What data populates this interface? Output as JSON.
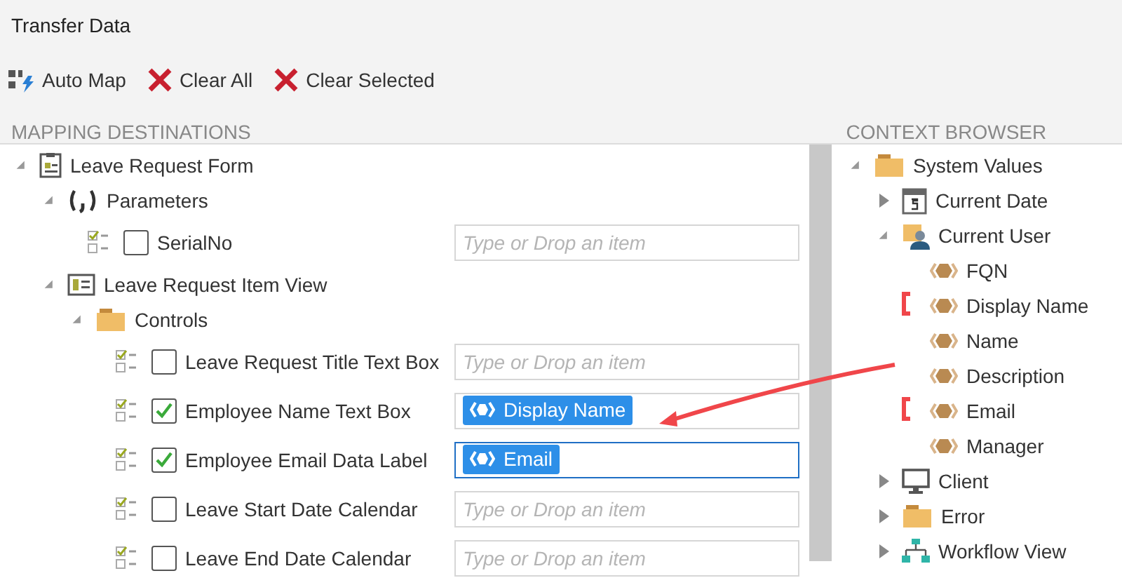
{
  "window": {
    "title": "Transfer Data"
  },
  "toolbar": [
    {
      "kind": "automap",
      "label": "Auto Map"
    },
    {
      "kind": "clear",
      "label": "Clear All"
    },
    {
      "kind": "clear",
      "label": "Clear Selected"
    }
  ],
  "destinations": {
    "heading": "MAPPING DESTINATIONS",
    "items": [
      {
        "kind": "form",
        "label": "Leave Request Form",
        "expanded": true,
        "children": [
          {
            "kind": "parameters",
            "label": "Parameters",
            "expanded": true,
            "children": [
              {
                "kind": "field",
                "label": "SerialNo",
                "checked": false,
                "focused": false,
                "placeholder": "Type or Drop an item"
              }
            ]
          },
          {
            "kind": "view",
            "label": "Leave Request Item View",
            "expanded": true,
            "children": [
              {
                "kind": "folder",
                "label": "Controls",
                "expanded": true,
                "children": [
                  {
                    "kind": "field",
                    "label": "Leave Request Title Text Box",
                    "checked": false,
                    "focused": false,
                    "placeholder": "Type or Drop an item"
                  },
                  {
                    "kind": "field",
                    "label": "Employee Name Text Box",
                    "checked": true,
                    "focused": false,
                    "token": "Display Name"
                  },
                  {
                    "kind": "field",
                    "label": "Employee Email Data Label",
                    "checked": true,
                    "focused": true,
                    "token": "Email"
                  },
                  {
                    "kind": "field",
                    "label": "Leave Start Date Calendar",
                    "checked": false,
                    "focused": false,
                    "placeholder": "Type or Drop an item"
                  },
                  {
                    "kind": "field",
                    "label": "Leave End Date Calendar",
                    "checked": false,
                    "focused": false,
                    "placeholder": "Type or Drop an item"
                  }
                ]
              }
            ]
          }
        ]
      }
    ]
  },
  "context": {
    "heading": "CONTEXT BROWSER",
    "items": [
      {
        "kind": "folder",
        "label": "System Values",
        "expanded": true,
        "children": [
          {
            "kind": "calendar",
            "label": "Current Date",
            "expanded": false
          },
          {
            "kind": "user-folder",
            "label": "Current User",
            "expanded": true,
            "children": [
              {
                "kind": "property",
                "label": "FQN",
                "highlighted": false
              },
              {
                "kind": "property",
                "label": "Display Name",
                "highlighted": true
              },
              {
                "kind": "property",
                "label": "Name",
                "highlighted": false
              },
              {
                "kind": "property",
                "label": "Description",
                "highlighted": false
              },
              {
                "kind": "property",
                "label": "Email",
                "highlighted": true
              },
              {
                "kind": "property",
                "label": "Manager",
                "highlighted": false
              }
            ]
          },
          {
            "kind": "monitor",
            "label": "Client",
            "expanded": false
          },
          {
            "kind": "folder",
            "label": "Error",
            "expanded": false
          },
          {
            "kind": "workflow",
            "label": "Workflow View",
            "expanded": false
          }
        ]
      }
    ]
  }
}
